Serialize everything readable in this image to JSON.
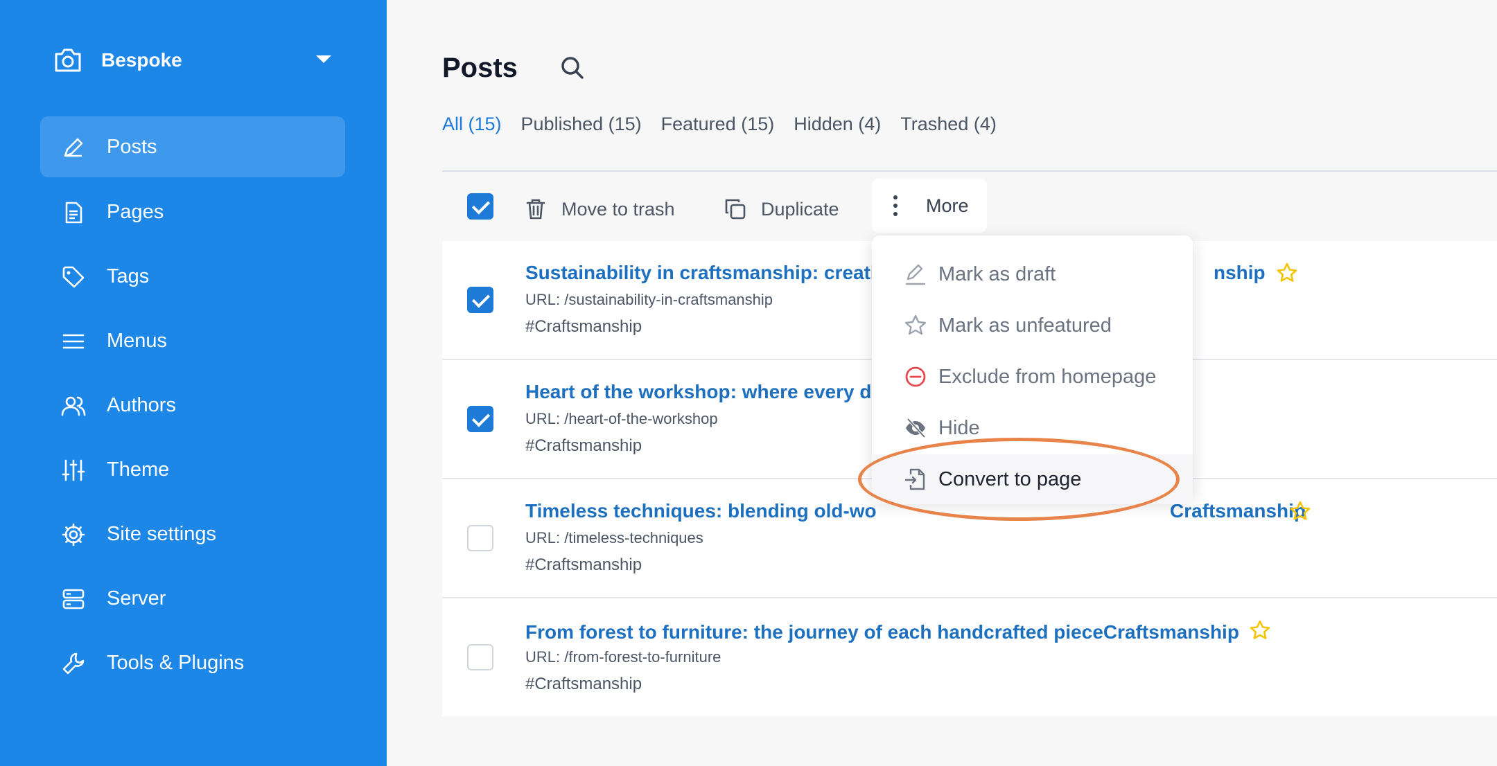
{
  "site": {
    "name": "Bespoke"
  },
  "sidebar": {
    "items": [
      {
        "label": "Posts",
        "icon": "pencil-icon",
        "active": true
      },
      {
        "label": "Pages",
        "icon": "document-icon"
      },
      {
        "label": "Tags",
        "icon": "tag-icon"
      },
      {
        "label": "Menus",
        "icon": "menu-lines-icon"
      },
      {
        "label": "Authors",
        "icon": "users-icon"
      },
      {
        "label": "Theme",
        "icon": "sliders-icon"
      },
      {
        "label": "Site settings",
        "icon": "gear-icon"
      },
      {
        "label": "Server",
        "icon": "server-icon"
      },
      {
        "label": "Tools & Plugins",
        "icon": "wrench-icon"
      }
    ]
  },
  "header": {
    "title": "Posts"
  },
  "filters": [
    {
      "label": "All (15)",
      "active": true
    },
    {
      "label": "Published (15)"
    },
    {
      "label": "Featured (15)"
    },
    {
      "label": "Hidden (4)"
    },
    {
      "label": "Trashed (4)"
    }
  ],
  "toolbar": {
    "trash_label": "Move to trash",
    "duplicate_label": "Duplicate",
    "more_label": "More"
  },
  "posts": [
    {
      "title": "Sustainability in craftsmanship: creati",
      "title_tail": "nship",
      "url": "URL: /sustainability-in-craftsmanship",
      "tag": "#Craftsmanship",
      "checked": true,
      "featured": true
    },
    {
      "title": "Heart of the workshop: where every de",
      "title_tail": "",
      "url": "URL: /heart-of-the-workshop",
      "tag": "#Craftsmanship",
      "checked": true,
      "featured": false
    },
    {
      "title": "Timeless techniques: blending old-wo",
      "title_tail": "Craftsmanship",
      "url": "URL: /timeless-techniques",
      "tag": "#Craftsmanship",
      "checked": false,
      "featured": true
    },
    {
      "title": "From forest to furniture: the journey of each handcrafted pieceCraftsmanship",
      "title_tail": "",
      "url": "URL: /from-forest-to-furniture",
      "tag": "#Craftsmanship",
      "checked": false,
      "featured": true
    }
  ],
  "more_menu": {
    "items": [
      {
        "label": "Mark as draft",
        "icon": "pencil-underline-icon"
      },
      {
        "label": "Mark as unfeatured",
        "icon": "star-outline-icon"
      },
      {
        "label": "Exclude from homepage",
        "icon": "minus-circle-icon"
      },
      {
        "label": "Hide",
        "icon": "eye-slash-icon"
      },
      {
        "label": "Convert to page",
        "icon": "file-import-icon",
        "highlighted": true
      }
    ]
  },
  "colors": {
    "sidebar": "#1d87e8",
    "accent": "#1d7ad6",
    "star": "#f5c400",
    "danger": "#e5484d",
    "annotation": "#e8834a"
  }
}
